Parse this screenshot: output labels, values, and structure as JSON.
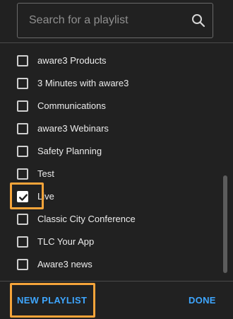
{
  "search": {
    "placeholder": "Search for a playlist",
    "value": "",
    "icon": "search-icon"
  },
  "playlists": [
    {
      "label": "aware3 Products",
      "checked": false
    },
    {
      "label": "3 Minutes with aware3",
      "checked": false
    },
    {
      "label": "Communications",
      "checked": false
    },
    {
      "label": "aware3 Webinars",
      "checked": false
    },
    {
      "label": "Safety Planning",
      "checked": false
    },
    {
      "label": "Test",
      "checked": false
    },
    {
      "label": "Live",
      "checked": true
    },
    {
      "label": "Classic City Conference",
      "checked": false
    },
    {
      "label": "TLC Your App",
      "checked": false
    },
    {
      "label": "Aware3 news",
      "checked": false
    }
  ],
  "footer": {
    "new_playlist_label": "NEW PLAYLIST",
    "done_label": "DONE"
  },
  "colors": {
    "panel_bg": "#212121",
    "accent": "#3ea6ff",
    "highlight": "#f5a43a"
  }
}
